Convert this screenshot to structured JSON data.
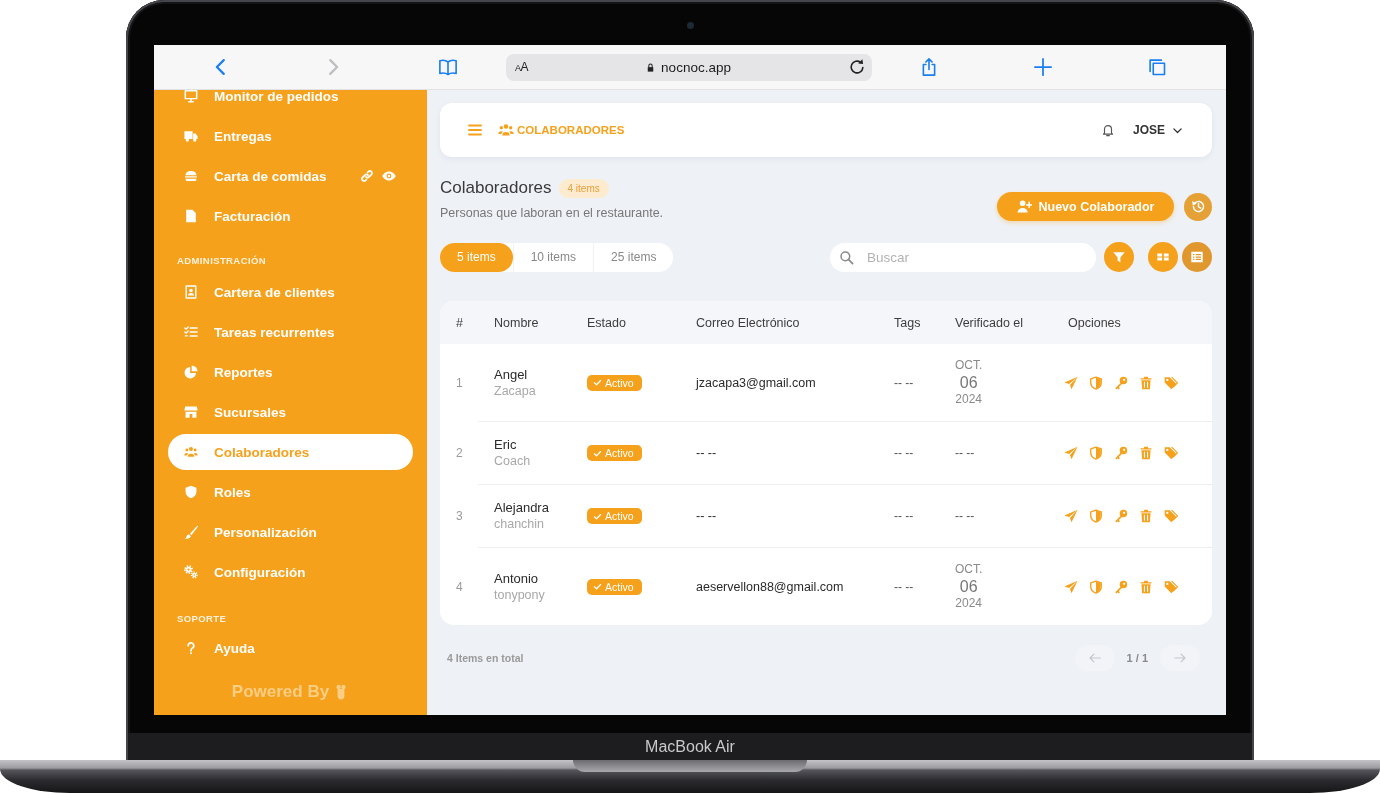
{
  "device": {
    "label": "MacBook Air"
  },
  "browser": {
    "nav": [
      {
        "kind": "back",
        "disabled": false
      },
      {
        "kind": "forward",
        "disabled": true
      }
    ],
    "text_size": "AA",
    "url": "nocnoc.app"
  },
  "sidebar": {
    "sections": [
      {
        "items": [
          {
            "label": "Monitor de pedidos",
            "selected": false
          },
          {
            "label": "Entregas",
            "selected": false
          },
          {
            "label": "Carta de comidas",
            "selected": false
          },
          {
            "label": "Facturación",
            "selected": false
          }
        ]
      },
      {
        "heading": "ADMINISTRACIÓN",
        "items": [
          {
            "label": "Cartera de clientes",
            "selected": false
          },
          {
            "label": "Tareas recurrentes",
            "selected": false
          },
          {
            "label": "Reportes",
            "selected": false
          },
          {
            "label": "Sucursales",
            "selected": false
          },
          {
            "label": "Colaboradores",
            "selected": true
          },
          {
            "label": "Roles",
            "selected": false
          },
          {
            "label": "Personalización",
            "selected": false
          },
          {
            "label": "Configuración",
            "selected": false
          }
        ]
      },
      {
        "heading": "SOPORTE",
        "items": [
          {
            "label": "Ayuda",
            "selected": false
          }
        ]
      }
    ],
    "powered_by": "Powered By"
  },
  "header": {
    "title": "COLABORADORES",
    "user": "JOSE"
  },
  "page": {
    "title": "Colaboradores",
    "count": "4 items",
    "subtitle": "Personas que laboran en el restaurante.",
    "new_button": "Nuevo Colaborador"
  },
  "page_sizes": [
    {
      "label": "5 items",
      "selected": true
    },
    {
      "label": "10 items",
      "selected": false
    },
    {
      "label": "25 items",
      "selected": false
    }
  ],
  "search": {
    "placeholder": "Buscar"
  },
  "view_modes": [
    {
      "selected": false
    },
    {
      "selected": true
    }
  ],
  "table": {
    "columns": [
      "#",
      "Nombre",
      "Estado",
      "Correo Electrónico",
      "Tags",
      "Verificado el",
      "Opciones"
    ],
    "rows": [
      {
        "number": "1",
        "name": "Angel",
        "secondary": "Zacapa",
        "status": "Activo",
        "email": "jzacapa3@gmail.com",
        "tags": "-- --",
        "verified": {
          "kind": "date",
          "month": "OCT.",
          "day": "06",
          "year": "2024"
        }
      },
      {
        "number": "2",
        "name": "Eric",
        "secondary": "Coach",
        "status": "Activo",
        "email": "-- --",
        "tags": "-- --",
        "verified": {
          "kind": "empty",
          "text": "-- --"
        }
      },
      {
        "number": "3",
        "name": "Alejandra",
        "secondary": "chanchin",
        "status": "Activo",
        "email": "-- --",
        "tags": "-- --",
        "verified": {
          "kind": "empty",
          "text": "-- --"
        }
      },
      {
        "number": "4",
        "name": "Antonio",
        "secondary": "tonypony",
        "status": "Activo",
        "email": "aeservellon88@gmail.com",
        "tags": "-- --",
        "verified": {
          "kind": "date",
          "month": "OCT.",
          "day": "06",
          "year": "2024"
        }
      }
    ]
  },
  "footer": {
    "total": "4 Items en total",
    "page": "1 / 1",
    "prev_disabled": true,
    "next_disabled": true
  }
}
